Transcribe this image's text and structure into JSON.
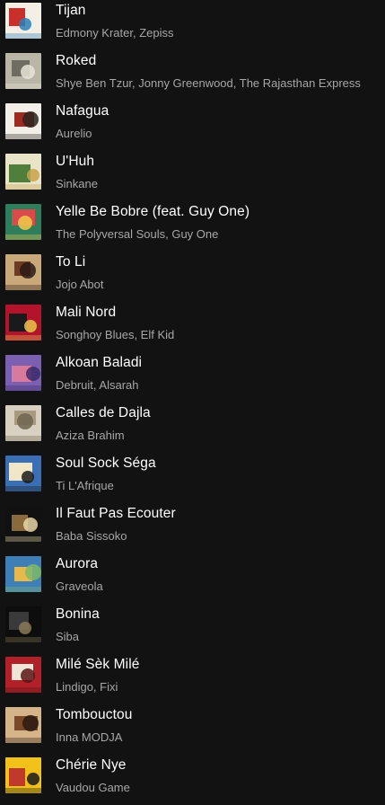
{
  "tracks": [
    {
      "title": "Tijan",
      "artist": "Edmony Krater, Zepiss",
      "art_colors": [
        "#f4efe4",
        "#c9302c",
        "#2a7fb8"
      ],
      "art_icon": "album-art"
    },
    {
      "title": "Roked",
      "artist": "Shye Ben Tzur, Jonny Greenwood, The Rajasthan Express",
      "art_colors": [
        "#b9b6a8",
        "#6f6c63",
        "#e8e4d6"
      ],
      "art_icon": "album-art"
    },
    {
      "title": "Nafagua",
      "artist": "Aurelio",
      "art_colors": [
        "#f2efe8",
        "#9c2a1e",
        "#2b2420"
      ],
      "art_icon": "album-art"
    },
    {
      "title": "U'Huh",
      "artist": "Sinkane",
      "art_colors": [
        "#e9e3c8",
        "#4f7f3a",
        "#c9a24a"
      ],
      "art_icon": "album-art"
    },
    {
      "title": "Yelle Be Bobre (feat. Guy One)",
      "artist": "The Polyversal Souls, Guy One",
      "art_colors": [
        "#2e7d5b",
        "#d94a4a",
        "#f2c94c"
      ],
      "art_icon": "album-art"
    },
    {
      "title": "To Li",
      "artist": "Jojo Abot",
      "art_colors": [
        "#c9a97a",
        "#6d3a22",
        "#2a1a14"
      ],
      "art_icon": "album-art"
    },
    {
      "title": "Mali Nord",
      "artist": "Songhoy Blues, Elf Kid",
      "art_colors": [
        "#b3142c",
        "#1a1a1a",
        "#e8c64a"
      ],
      "art_icon": "album-art"
    },
    {
      "title": "Alkoan Baladi",
      "artist": "Debruit, Alsarah",
      "art_colors": [
        "#7b5fb0",
        "#d87a9c",
        "#3b2a6e"
      ],
      "art_icon": "album-art"
    },
    {
      "title": "Calles de Dajla",
      "artist": "Aziza Brahim",
      "art_colors": [
        "#d8d1c2",
        "#a89a80",
        "#6f6550"
      ],
      "art_icon": "album-art"
    },
    {
      "title": "Soul Sock Séga",
      "artist": "Ti L'Afrique",
      "art_colors": [
        "#3a6fb6",
        "#f2e6c9",
        "#1a1a1a"
      ],
      "art_icon": "album-art"
    },
    {
      "title": "Il Faut Pas Ecouter",
      "artist": "Baba Sissoko",
      "art_colors": [
        "#111111",
        "#8a6a3a",
        "#e6d6a8"
      ],
      "art_icon": "album-art"
    },
    {
      "title": "Aurora",
      "artist": "Graveola",
      "art_colors": [
        "#3f7fb8",
        "#e7b84a",
        "#7bb86a"
      ],
      "art_icon": "album-art"
    },
    {
      "title": "Bonina",
      "artist": "Siba",
      "art_colors": [
        "#0d0d0d",
        "#3a3a3a",
        "#8a7a5a"
      ],
      "art_icon": "album-art"
    },
    {
      "title": "Milé Sèk Milé",
      "artist": "Lindigo, Fixi",
      "art_colors": [
        "#b2202a",
        "#f0e6d8",
        "#5a1414"
      ],
      "art_icon": "album-art"
    },
    {
      "title": "Tombouctou",
      "artist": "Inna MODJA",
      "art_colors": [
        "#d6b48a",
        "#7a4a2a",
        "#2a1a10"
      ],
      "art_icon": "album-art"
    },
    {
      "title": "Chérie Nye",
      "artist": "Vaudou Game",
      "art_colors": [
        "#f2c21b",
        "#c0392b",
        "#1a1a1a"
      ],
      "art_icon": "album-art"
    }
  ]
}
